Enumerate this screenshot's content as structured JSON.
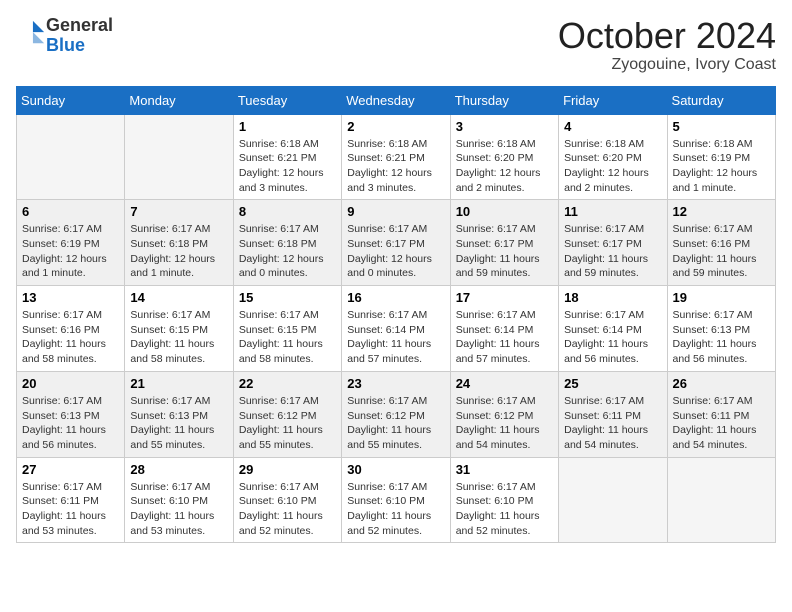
{
  "header": {
    "logo_general": "General",
    "logo_blue": "Blue",
    "month_title": "October 2024",
    "location": "Zyogouine, Ivory Coast"
  },
  "weekdays": [
    "Sunday",
    "Monday",
    "Tuesday",
    "Wednesday",
    "Thursday",
    "Friday",
    "Saturday"
  ],
  "weeks": [
    {
      "shaded": false,
      "days": [
        {
          "date": "",
          "info": ""
        },
        {
          "date": "",
          "info": ""
        },
        {
          "date": "1",
          "info": "Sunrise: 6:18 AM\nSunset: 6:21 PM\nDaylight: 12 hours and 3 minutes."
        },
        {
          "date": "2",
          "info": "Sunrise: 6:18 AM\nSunset: 6:21 PM\nDaylight: 12 hours and 3 minutes."
        },
        {
          "date": "3",
          "info": "Sunrise: 6:18 AM\nSunset: 6:20 PM\nDaylight: 12 hours and 2 minutes."
        },
        {
          "date": "4",
          "info": "Sunrise: 6:18 AM\nSunset: 6:20 PM\nDaylight: 12 hours and 2 minutes."
        },
        {
          "date": "5",
          "info": "Sunrise: 6:18 AM\nSunset: 6:19 PM\nDaylight: 12 hours and 1 minute."
        }
      ]
    },
    {
      "shaded": true,
      "days": [
        {
          "date": "6",
          "info": "Sunrise: 6:17 AM\nSunset: 6:19 PM\nDaylight: 12 hours and 1 minute."
        },
        {
          "date": "7",
          "info": "Sunrise: 6:17 AM\nSunset: 6:18 PM\nDaylight: 12 hours and 1 minute."
        },
        {
          "date": "8",
          "info": "Sunrise: 6:17 AM\nSunset: 6:18 PM\nDaylight: 12 hours and 0 minutes."
        },
        {
          "date": "9",
          "info": "Sunrise: 6:17 AM\nSunset: 6:17 PM\nDaylight: 12 hours and 0 minutes."
        },
        {
          "date": "10",
          "info": "Sunrise: 6:17 AM\nSunset: 6:17 PM\nDaylight: 11 hours and 59 minutes."
        },
        {
          "date": "11",
          "info": "Sunrise: 6:17 AM\nSunset: 6:17 PM\nDaylight: 11 hours and 59 minutes."
        },
        {
          "date": "12",
          "info": "Sunrise: 6:17 AM\nSunset: 6:16 PM\nDaylight: 11 hours and 59 minutes."
        }
      ]
    },
    {
      "shaded": false,
      "days": [
        {
          "date": "13",
          "info": "Sunrise: 6:17 AM\nSunset: 6:16 PM\nDaylight: 11 hours and 58 minutes."
        },
        {
          "date": "14",
          "info": "Sunrise: 6:17 AM\nSunset: 6:15 PM\nDaylight: 11 hours and 58 minutes."
        },
        {
          "date": "15",
          "info": "Sunrise: 6:17 AM\nSunset: 6:15 PM\nDaylight: 11 hours and 58 minutes."
        },
        {
          "date": "16",
          "info": "Sunrise: 6:17 AM\nSunset: 6:14 PM\nDaylight: 11 hours and 57 minutes."
        },
        {
          "date": "17",
          "info": "Sunrise: 6:17 AM\nSunset: 6:14 PM\nDaylight: 11 hours and 57 minutes."
        },
        {
          "date": "18",
          "info": "Sunrise: 6:17 AM\nSunset: 6:14 PM\nDaylight: 11 hours and 56 minutes."
        },
        {
          "date": "19",
          "info": "Sunrise: 6:17 AM\nSunset: 6:13 PM\nDaylight: 11 hours and 56 minutes."
        }
      ]
    },
    {
      "shaded": true,
      "days": [
        {
          "date": "20",
          "info": "Sunrise: 6:17 AM\nSunset: 6:13 PM\nDaylight: 11 hours and 56 minutes."
        },
        {
          "date": "21",
          "info": "Sunrise: 6:17 AM\nSunset: 6:13 PM\nDaylight: 11 hours and 55 minutes."
        },
        {
          "date": "22",
          "info": "Sunrise: 6:17 AM\nSunset: 6:12 PM\nDaylight: 11 hours and 55 minutes."
        },
        {
          "date": "23",
          "info": "Sunrise: 6:17 AM\nSunset: 6:12 PM\nDaylight: 11 hours and 55 minutes."
        },
        {
          "date": "24",
          "info": "Sunrise: 6:17 AM\nSunset: 6:12 PM\nDaylight: 11 hours and 54 minutes."
        },
        {
          "date": "25",
          "info": "Sunrise: 6:17 AM\nSunset: 6:11 PM\nDaylight: 11 hours and 54 minutes."
        },
        {
          "date": "26",
          "info": "Sunrise: 6:17 AM\nSunset: 6:11 PM\nDaylight: 11 hours and 54 minutes."
        }
      ]
    },
    {
      "shaded": false,
      "days": [
        {
          "date": "27",
          "info": "Sunrise: 6:17 AM\nSunset: 6:11 PM\nDaylight: 11 hours and 53 minutes."
        },
        {
          "date": "28",
          "info": "Sunrise: 6:17 AM\nSunset: 6:10 PM\nDaylight: 11 hours and 53 minutes."
        },
        {
          "date": "29",
          "info": "Sunrise: 6:17 AM\nSunset: 6:10 PM\nDaylight: 11 hours and 52 minutes."
        },
        {
          "date": "30",
          "info": "Sunrise: 6:17 AM\nSunset: 6:10 PM\nDaylight: 11 hours and 52 minutes."
        },
        {
          "date": "31",
          "info": "Sunrise: 6:17 AM\nSunset: 6:10 PM\nDaylight: 11 hours and 52 minutes."
        },
        {
          "date": "",
          "info": ""
        },
        {
          "date": "",
          "info": ""
        }
      ]
    }
  ]
}
